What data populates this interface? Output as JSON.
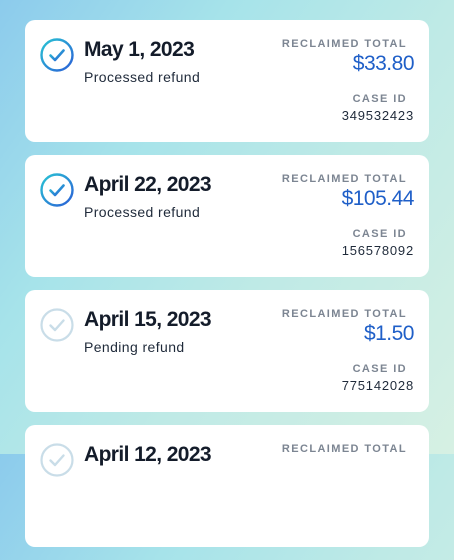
{
  "labels": {
    "reclaimed_total": "RECLAIMED TOTAL",
    "case_id": "CASE ID"
  },
  "colors": {
    "accent_blue": "#1f5fc8",
    "check_gradient_start": "#29c4d4",
    "check_gradient_end": "#2a5fd6",
    "pending_check": "#c9dde8"
  },
  "refunds": [
    {
      "date": "May 1, 2023",
      "status": "Processed refund",
      "state": "processed",
      "icon": "check-circle-icon",
      "amount": "$33.80",
      "case_id": "349532423"
    },
    {
      "date": "April 22, 2023",
      "status": "Processed refund",
      "state": "processed",
      "icon": "check-circle-icon",
      "amount": "$105.44",
      "case_id": "156578092"
    },
    {
      "date": "April 15, 2023",
      "status": "Pending refund",
      "state": "pending",
      "icon": "check-circle-icon",
      "amount": "$1.50",
      "case_id": "775142028"
    },
    {
      "date": "April 12, 2023",
      "status": "",
      "state": "pending",
      "icon": "check-circle-icon",
      "amount": "",
      "case_id": ""
    }
  ]
}
